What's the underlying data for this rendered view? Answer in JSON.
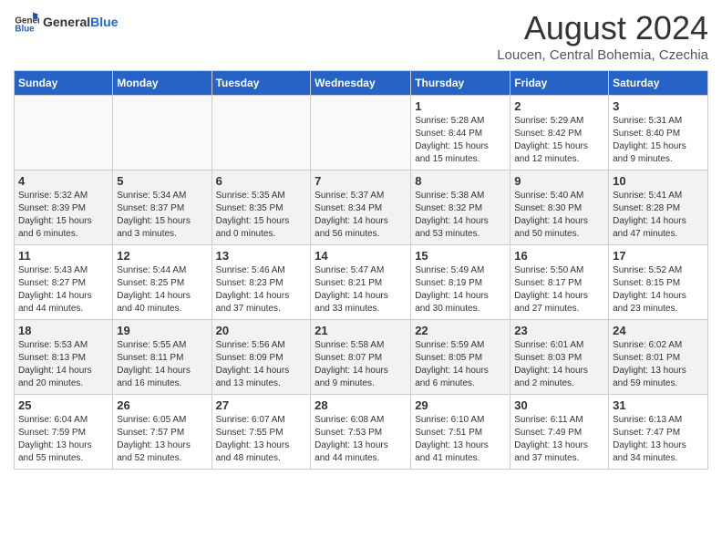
{
  "header": {
    "logo_general": "General",
    "logo_blue": "Blue",
    "month_year": "August 2024",
    "location": "Loucen, Central Bohemia, Czechia"
  },
  "weekdays": [
    "Sunday",
    "Monday",
    "Tuesday",
    "Wednesday",
    "Thursday",
    "Friday",
    "Saturday"
  ],
  "weeks": [
    [
      {
        "day": "",
        "info": ""
      },
      {
        "day": "",
        "info": ""
      },
      {
        "day": "",
        "info": ""
      },
      {
        "day": "",
        "info": ""
      },
      {
        "day": "1",
        "info": "Sunrise: 5:28 AM\nSunset: 8:44 PM\nDaylight: 15 hours\nand 15 minutes."
      },
      {
        "day": "2",
        "info": "Sunrise: 5:29 AM\nSunset: 8:42 PM\nDaylight: 15 hours\nand 12 minutes."
      },
      {
        "day": "3",
        "info": "Sunrise: 5:31 AM\nSunset: 8:40 PM\nDaylight: 15 hours\nand 9 minutes."
      }
    ],
    [
      {
        "day": "4",
        "info": "Sunrise: 5:32 AM\nSunset: 8:39 PM\nDaylight: 15 hours\nand 6 minutes."
      },
      {
        "day": "5",
        "info": "Sunrise: 5:34 AM\nSunset: 8:37 PM\nDaylight: 15 hours\nand 3 minutes."
      },
      {
        "day": "6",
        "info": "Sunrise: 5:35 AM\nSunset: 8:35 PM\nDaylight: 15 hours\nand 0 minutes."
      },
      {
        "day": "7",
        "info": "Sunrise: 5:37 AM\nSunset: 8:34 PM\nDaylight: 14 hours\nand 56 minutes."
      },
      {
        "day": "8",
        "info": "Sunrise: 5:38 AM\nSunset: 8:32 PM\nDaylight: 14 hours\nand 53 minutes."
      },
      {
        "day": "9",
        "info": "Sunrise: 5:40 AM\nSunset: 8:30 PM\nDaylight: 14 hours\nand 50 minutes."
      },
      {
        "day": "10",
        "info": "Sunrise: 5:41 AM\nSunset: 8:28 PM\nDaylight: 14 hours\nand 47 minutes."
      }
    ],
    [
      {
        "day": "11",
        "info": "Sunrise: 5:43 AM\nSunset: 8:27 PM\nDaylight: 14 hours\nand 44 minutes."
      },
      {
        "day": "12",
        "info": "Sunrise: 5:44 AM\nSunset: 8:25 PM\nDaylight: 14 hours\nand 40 minutes."
      },
      {
        "day": "13",
        "info": "Sunrise: 5:46 AM\nSunset: 8:23 PM\nDaylight: 14 hours\nand 37 minutes."
      },
      {
        "day": "14",
        "info": "Sunrise: 5:47 AM\nSunset: 8:21 PM\nDaylight: 14 hours\nand 33 minutes."
      },
      {
        "day": "15",
        "info": "Sunrise: 5:49 AM\nSunset: 8:19 PM\nDaylight: 14 hours\nand 30 minutes."
      },
      {
        "day": "16",
        "info": "Sunrise: 5:50 AM\nSunset: 8:17 PM\nDaylight: 14 hours\nand 27 minutes."
      },
      {
        "day": "17",
        "info": "Sunrise: 5:52 AM\nSunset: 8:15 PM\nDaylight: 14 hours\nand 23 minutes."
      }
    ],
    [
      {
        "day": "18",
        "info": "Sunrise: 5:53 AM\nSunset: 8:13 PM\nDaylight: 14 hours\nand 20 minutes."
      },
      {
        "day": "19",
        "info": "Sunrise: 5:55 AM\nSunset: 8:11 PM\nDaylight: 14 hours\nand 16 minutes."
      },
      {
        "day": "20",
        "info": "Sunrise: 5:56 AM\nSunset: 8:09 PM\nDaylight: 14 hours\nand 13 minutes."
      },
      {
        "day": "21",
        "info": "Sunrise: 5:58 AM\nSunset: 8:07 PM\nDaylight: 14 hours\nand 9 minutes."
      },
      {
        "day": "22",
        "info": "Sunrise: 5:59 AM\nSunset: 8:05 PM\nDaylight: 14 hours\nand 6 minutes."
      },
      {
        "day": "23",
        "info": "Sunrise: 6:01 AM\nSunset: 8:03 PM\nDaylight: 14 hours\nand 2 minutes."
      },
      {
        "day": "24",
        "info": "Sunrise: 6:02 AM\nSunset: 8:01 PM\nDaylight: 13 hours\nand 59 minutes."
      }
    ],
    [
      {
        "day": "25",
        "info": "Sunrise: 6:04 AM\nSunset: 7:59 PM\nDaylight: 13 hours\nand 55 minutes."
      },
      {
        "day": "26",
        "info": "Sunrise: 6:05 AM\nSunset: 7:57 PM\nDaylight: 13 hours\nand 52 minutes."
      },
      {
        "day": "27",
        "info": "Sunrise: 6:07 AM\nSunset: 7:55 PM\nDaylight: 13 hours\nand 48 minutes."
      },
      {
        "day": "28",
        "info": "Sunrise: 6:08 AM\nSunset: 7:53 PM\nDaylight: 13 hours\nand 44 minutes."
      },
      {
        "day": "29",
        "info": "Sunrise: 6:10 AM\nSunset: 7:51 PM\nDaylight: 13 hours\nand 41 minutes."
      },
      {
        "day": "30",
        "info": "Sunrise: 6:11 AM\nSunset: 7:49 PM\nDaylight: 13 hours\nand 37 minutes."
      },
      {
        "day": "31",
        "info": "Sunrise: 6:13 AM\nSunset: 7:47 PM\nDaylight: 13 hours\nand 34 minutes."
      }
    ]
  ]
}
